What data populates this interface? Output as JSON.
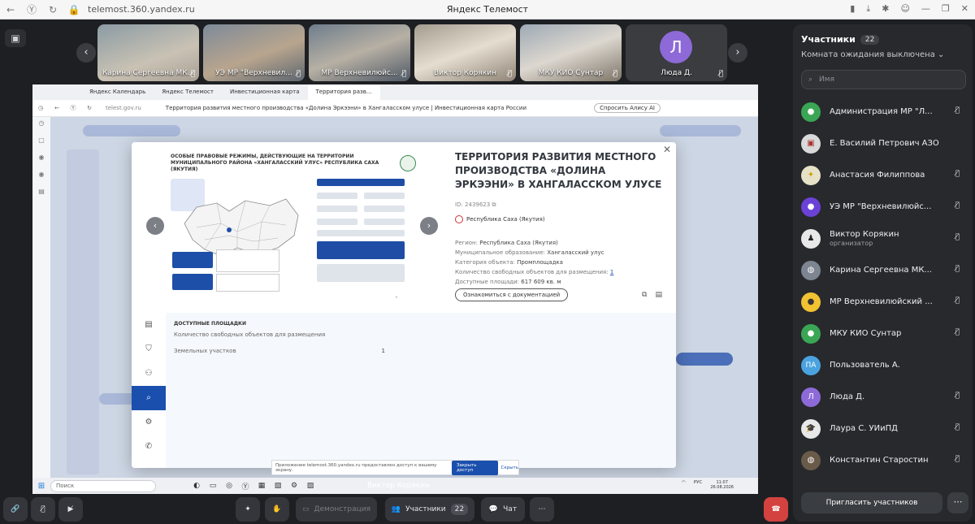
{
  "browser": {
    "url": "telemost.360.yandex.ru",
    "title": "Яндекс Телемост"
  },
  "video_strip": {
    "tiles": [
      {
        "name": "Карина Сергеевна МК..."
      },
      {
        "name": "УЭ МР \"Верхневил..."
      },
      {
        "name": "МР Верхневилюйс..."
      },
      {
        "name": "Виктор Корякин"
      },
      {
        "name": "МКУ КИО Сунтар"
      },
      {
        "name": "Люда Д.",
        "initial": "Л"
      }
    ]
  },
  "shared_screen": {
    "tabs": [
      "Яндекс Календарь",
      "Яндекс Телемост",
      "Инвестиционная карта",
      "Территория разв..."
    ],
    "url": "telest.gov.ru",
    "page_title": "Территория развития местного производства «Долина Эркээни» в Хангаласском улусе | Инвестиционная карта России",
    "alice_label": "Спросить Алису AI",
    "map": {
      "title": "ОСОБЫЕ ПРАВОВЫЕ РЕЖИМЫ, ДЕЙСТВУЮЩИЕ НА ТЕРРИТОРИИ МУНИЦИПАЛЬНОГО РАЙОНА «ХАНГАЛАССКИЙ УЛУС» РЕСПУБЛИКА САХА (ЯКУТИЯ)"
    },
    "object": {
      "heading": "ТЕРРИТОРИЯ РАЗВИТИЯ МЕСТНОГО ПРОИЗВОДСТВА «ДОЛИНА ЭРКЭЭНИ» В ХАНГАЛАССКОМ УЛУСЕ",
      "id": "ID: 2439623",
      "region_badge": "Республика Саха (Якутия)",
      "region_label": "Регион:",
      "region_value": "Республика Саха (Якутия)",
      "municipality_label": "Муниципальное образование:",
      "municipality_value": "Хангаласский улус",
      "category_label": "Категория объекта:",
      "category_value": "Промплощадка",
      "free_objects_label": "Количество свободных объектов для размещения:",
      "free_objects_value": "1",
      "area_label": "Доступные площади:",
      "area_value": "617 609 кв. м",
      "docs_button": "Ознакомиться с документацией"
    },
    "lower": {
      "title": "ДОСТУПНЫЕ ПЛОЩАДКИ",
      "row1_label": "Количество свободных объектов для размещения",
      "row2_label": "Земельных участков",
      "row2_value": "1"
    },
    "share_bar": {
      "text": "Приложение telemost.360.yandex.ru предоставлен доступ к вашему экрану.",
      "open_button": "Закрыть доступ",
      "hide_link": "Скрыть"
    },
    "taskbar": {
      "search": "Поиск",
      "lang": "РУС",
      "time": "11:07",
      "date": "26.08.2026"
    }
  },
  "speaker_label": "Виктор Корякин",
  "controls": {
    "demo": "Демонстрация",
    "participants": "Участники",
    "participants_count": "22",
    "chat": "Чат"
  },
  "panel": {
    "title": "Участники",
    "count": "22",
    "waiting_room": "Комната ожидания выключена",
    "search_placeholder": "Имя",
    "participants": [
      {
        "name": "Администрация МР \"Л...",
        "role": "",
        "initial": "",
        "color": "#3aa655"
      },
      {
        "name": "Е. Василий Петрович АЗО",
        "role": "",
        "initial": "",
        "color": "#d9d9d9"
      },
      {
        "name": "Анастасия Филиппова",
        "role": "",
        "initial": "",
        "color": "#e7e1c8"
      },
      {
        "name": "УЭ МР \"Верхневилюйс...",
        "role": "",
        "initial": "",
        "color": "#6b42d6"
      },
      {
        "name": "Виктор Корякин",
        "role": "организатор",
        "initial": "",
        "color": "#e8e8e8"
      },
      {
        "name": "Карина Сергеевна МК...",
        "role": "",
        "initial": "",
        "color": "#7d8590"
      },
      {
        "name": "МР Верхневилюйский ...",
        "role": "",
        "initial": "",
        "color": "#f1c232"
      },
      {
        "name": "МКУ КИО Сунтар",
        "role": "",
        "initial": "",
        "color": "#3aa655"
      },
      {
        "name": "Пользователь А.",
        "role": "",
        "initial": "ПА",
        "color": "#4aa3df"
      },
      {
        "name": "Люда Д.",
        "role": "",
        "initial": "Л",
        "color": "#8d6ad7"
      },
      {
        "name": "Лаура С. УИиПД",
        "role": "",
        "initial": "",
        "color": "#e8e8e8"
      },
      {
        "name": "Константин Старостин",
        "role": "",
        "initial": "",
        "color": "#6a5a4a"
      }
    ],
    "invite_button": "Пригласить участников"
  }
}
